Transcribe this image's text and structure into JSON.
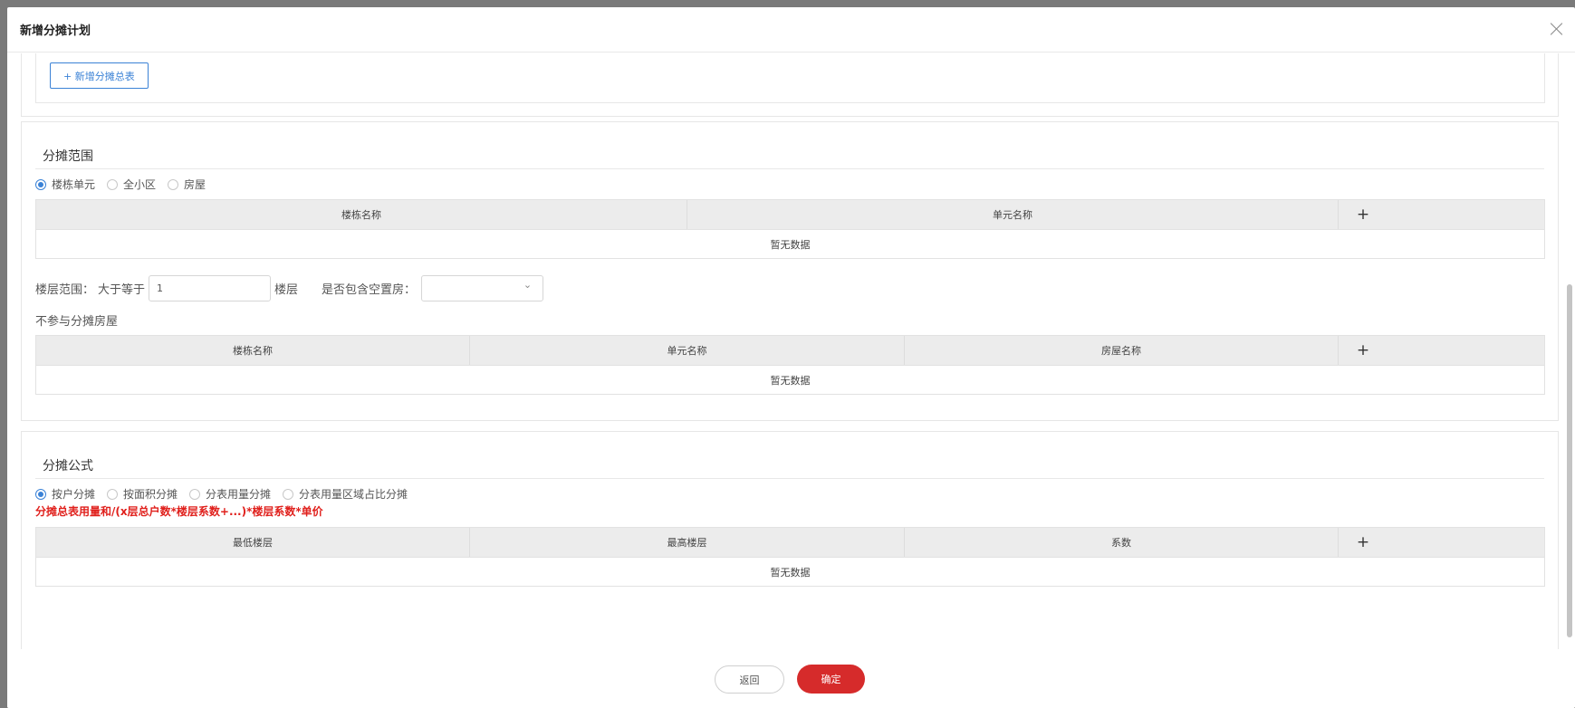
{
  "dialog": {
    "title": "新增分摊计划"
  },
  "summary": {
    "add_button": "+ 新增分摊总表"
  },
  "scope": {
    "title": "分摊范围",
    "radios": [
      {
        "label": "楼栋单元",
        "checked": true
      },
      {
        "label": "全小区",
        "checked": false
      },
      {
        "label": "房屋",
        "checked": false
      }
    ],
    "table": {
      "columns": [
        "楼栋名称",
        "单元名称"
      ],
      "add": "+",
      "empty": "暂无数据"
    },
    "floor_label": "楼层范围：",
    "floor_gte": "大于等于",
    "floor_value": "1",
    "floor_unit": "楼层",
    "vacant_label": "是否包含空置房：",
    "vacant_value": "",
    "excluded_label": "不参与分摊房屋",
    "excluded_table": {
      "columns": [
        "楼栋名称",
        "单元名称",
        "房屋名称"
      ],
      "add": "+",
      "empty": "暂无数据"
    }
  },
  "formula": {
    "title": "分摊公式",
    "radios": [
      {
        "label": "按户分摊",
        "checked": true
      },
      {
        "label": "按面积分摊",
        "checked": false
      },
      {
        "label": "分表用量分摊",
        "checked": false
      },
      {
        "label": "分表用量区域占比分摊",
        "checked": false
      }
    ],
    "text": "分摊总表用量和/(x层总户数*楼层系数+...)*楼层系数*单价",
    "table": {
      "columns": [
        "最低楼层",
        "最高楼层",
        "系数"
      ],
      "add": "+",
      "empty": "暂无数据"
    }
  },
  "footer": {
    "back": "返回",
    "confirm": "确定"
  },
  "colors": {
    "accent": "#3b82d6",
    "confirm": "#d62b2b",
    "formula_text": "#e0201c"
  },
  "icons": {
    "close": "close-icon",
    "add": "plus-icon",
    "select": "chevron-down-icon"
  }
}
